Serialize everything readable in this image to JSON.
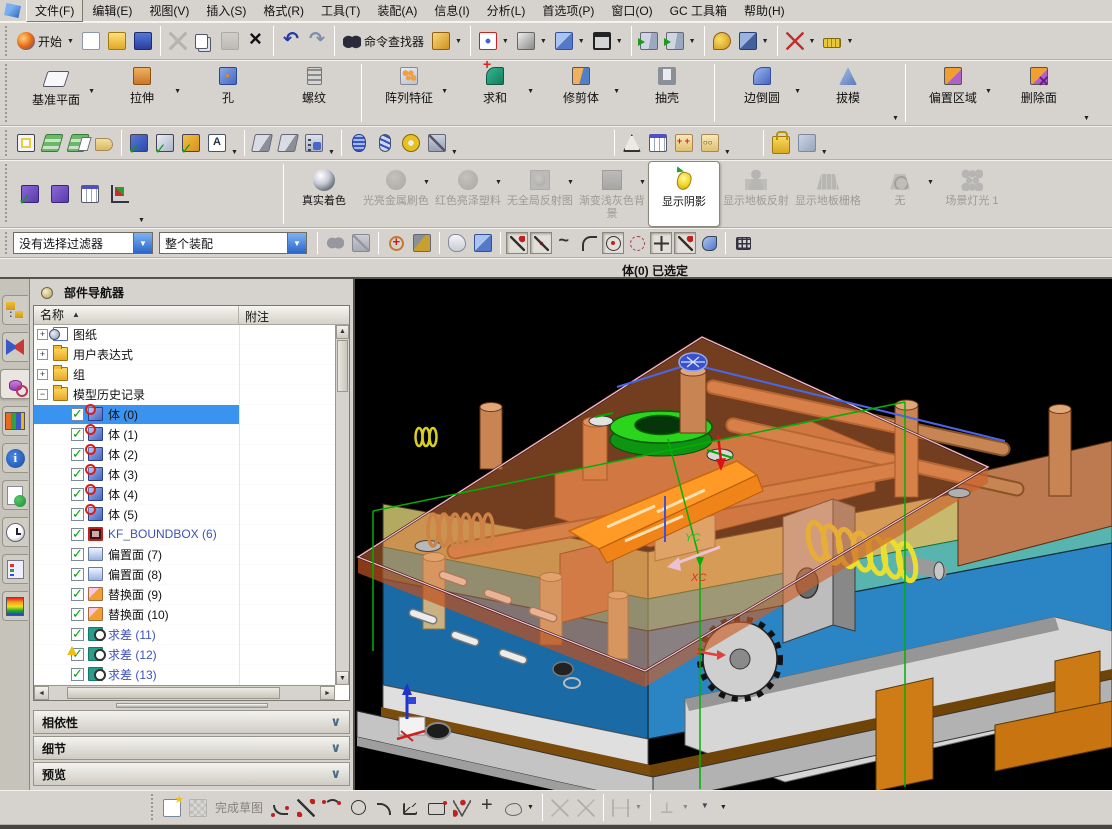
{
  "menu_bar": {
    "items": [
      "文件(F)",
      "编辑(E)",
      "视图(V)",
      "插入(S)",
      "格式(R)",
      "工具(T)",
      "装配(A)",
      "信息(I)",
      "分析(L)",
      "首选项(P)",
      "窗口(O)",
      "GC 工具箱",
      "帮助(H)"
    ]
  },
  "standard_toolbar": {
    "items": [
      {
        "icon": "nx-start-icon",
        "label": "开始",
        "dd": true
      },
      {
        "icon": "new-file-icon"
      },
      {
        "icon": "open-file-icon"
      },
      {
        "icon": "save-icon"
      },
      {
        "sep": true
      },
      {
        "icon": "cut-icon",
        "disabled": true
      },
      {
        "icon": "copy-icon"
      },
      {
        "icon": "paste-icon",
        "disabled": true
      },
      {
        "icon": "delete-icon"
      },
      {
        "sep": true
      },
      {
        "icon": "undo-icon"
      },
      {
        "icon": "redo-icon"
      },
      {
        "sep": true
      },
      {
        "icon": "command-finder-icon",
        "label": "命令查找器"
      },
      {
        "icon": "selection-box-icon",
        "dd": true
      },
      {
        "sep": true
      },
      {
        "icon": "fit-view-icon",
        "dd": true
      },
      {
        "icon": "shaded-view-icon",
        "dd": true
      },
      {
        "icon": "isometric-view-icon",
        "dd": true
      },
      {
        "icon": "window-bg-icon",
        "dd": true
      },
      {
        "sep": true
      },
      {
        "icon": "new-section-icon"
      },
      {
        "icon": "edit-section-icon",
        "dd": true
      },
      {
        "sep": true
      },
      {
        "icon": "appearance-icon"
      },
      {
        "icon": "render-style-icon",
        "dd": true
      },
      {
        "sep": true
      },
      {
        "icon": "measure-icon",
        "dd": true
      },
      {
        "icon": "ruler-icon",
        "dd": true
      }
    ]
  },
  "feature_toolbar": {
    "groups": [
      {
        "buttons": [
          {
            "label": "基准平面",
            "icon": "datum-plane-icon",
            "dd": true
          },
          {
            "label": "拉伸",
            "icon": "extrude-icon",
            "dd": true
          },
          {
            "label": "孔",
            "icon": "hole-icon"
          },
          {
            "label": "螺纹",
            "icon": "thread-icon"
          }
        ]
      },
      {
        "buttons": [
          {
            "label": "阵列特征",
            "icon": "pattern-feature-icon",
            "dd": true
          },
          {
            "label": "求和",
            "icon": "unite-icon",
            "dd": true
          },
          {
            "label": "修剪体",
            "icon": "trim-body-icon",
            "dd": true
          },
          {
            "label": "抽壳",
            "icon": "shell-icon"
          }
        ]
      },
      {
        "buttons": [
          {
            "label": "边倒圆",
            "icon": "edge-blend-icon",
            "dd": true
          },
          {
            "label": "拔模",
            "icon": "draft-icon"
          }
        ],
        "overflow": true
      },
      {
        "buttons": [
          {
            "label": "偏置区域",
            "icon": "offset-region-icon",
            "dd": true
          },
          {
            "label": "删除面",
            "icon": "delete-face-icon"
          }
        ],
        "overflow": true
      }
    ]
  },
  "utility_toolbar": {
    "groups": [
      {
        "icons": [
          "edit-display-icon",
          "layer-settings-icon",
          "layer-category-icon",
          "tag-icon"
        ]
      },
      {
        "icons": [
          "assembly-check-icon",
          "examine-geometry-icon",
          "feature-check-icon",
          "text-edit-icon"
        ],
        "overflow": true
      },
      {
        "icons": [
          "chamfer-check-icon",
          "deviation-icon",
          "select-hand-icon"
        ],
        "overflow": true
      },
      {
        "icons": [
          "coil-icon",
          "spring-icon",
          "washer-icon",
          "hide-component-icon"
        ],
        "overflow": true
      },
      {
        "gap": 150
      },
      {
        "icons": [
          "triangle-icon",
          "spreadsheet-icon",
          "point-cloud-icon",
          "curve-set-icon"
        ],
        "overflow": true
      },
      {
        "gap": 26
      },
      {
        "icons": [
          "lock-boxes-icon",
          "unlock-box-icon"
        ],
        "overflow": true
      }
    ]
  },
  "render_toolbar": {
    "left_icons": [
      "assembly-constraints-icon",
      "mating-icon",
      "expression-table-icon",
      "orient-view-icon"
    ],
    "buttons": [
      {
        "name": "true-shading",
        "label": "真实着色",
        "icon": "sphere-metal-icon",
        "enabled": true
      },
      {
        "name": "brushed-metal",
        "label": "光亮金属刷色",
        "icon": "sphere-dull-icon",
        "dd": true
      },
      {
        "name": "red-glossy-plastic",
        "label": "红色亮泽塑料",
        "icon": "sphere-dull-icon",
        "dd": true
      },
      {
        "name": "no-global-reflection",
        "label": "无全局反射图",
        "icon": "reflection-map-icon",
        "dd": true
      },
      {
        "name": "gradient-background",
        "label": "渐变浅灰色背景",
        "icon": "background-swatch-icon",
        "dd": true
      },
      {
        "name": "show-shadows",
        "label": "显示阴影",
        "icon": "bulb-icon",
        "enabled": true,
        "selected": true
      },
      {
        "name": "floor-reflection",
        "label": "显示地板反射",
        "icon": "floor-reflect-icon"
      },
      {
        "name": "floor-grid",
        "label": "显示地板栅格",
        "icon": "floor-grid-icon"
      },
      {
        "name": "floor-none",
        "label": "无",
        "icon": "floor-none-icon",
        "dd": true
      },
      {
        "name": "scene-lights",
        "label": "场景灯光 1",
        "icon": "scene-lights-icon"
      }
    ]
  },
  "selection_bar": {
    "filter_value": "没有选择过滤器",
    "scope_value": "整个装配",
    "icons": [
      "general-selection-icon",
      "deselect-icon",
      "rotate-wcs-icon",
      "snap-hammer-icon",
      "polygon-select-icon",
      "cube-select-icon"
    ],
    "snap_toggles": [
      {
        "icon": "snap-endpoint-icon",
        "cls": "sic-line",
        "pressed": true
      },
      {
        "icon": "snap-midpoint-icon",
        "cls": "sic-line2",
        "pressed": true
      },
      {
        "icon": "snap-curve-icon",
        "cls": "sic-curve"
      },
      {
        "icon": "snap-quadrant-icon",
        "cls": "sic-quad"
      },
      {
        "icon": "snap-center-icon",
        "cls": "sic-center",
        "pressed": true
      },
      {
        "icon": "snap-ellipse-icon",
        "cls": "sic-ellipse"
      },
      {
        "icon": "snap-intersection-icon",
        "cls": "sic-plus",
        "pressed": true
      },
      {
        "icon": "snap-point-on-curve-icon",
        "cls": "sic-line",
        "pressed": true
      },
      {
        "icon": "snap-face-icon",
        "cls": "sic-face"
      }
    ]
  },
  "status_bar": {
    "message": "体(0) 已选定"
  },
  "resource_bar": {
    "tabs": [
      {
        "icon": "assembly-navigator-icon"
      },
      {
        "icon": "constraint-navigator-icon"
      },
      {
        "icon": "part-navigator-icon",
        "selected": true
      },
      {
        "icon": "reuse-library-icon"
      },
      {
        "icon": "hd3d-tool-icon"
      },
      {
        "icon": "web-browser-icon"
      },
      {
        "icon": "history-icon"
      },
      {
        "icon": "system-materials-icon"
      },
      {
        "icon": "visualization-icon"
      }
    ]
  },
  "part_navigator": {
    "title": "部件导航器",
    "columns": [
      "名称",
      "附注"
    ],
    "tree": [
      {
        "label": "图纸",
        "expander": "+",
        "icon": "drawing-icon"
      },
      {
        "label": "用户表达式",
        "expander": "+",
        "icon": "folder-icon"
      },
      {
        "label": "组",
        "expander": "+",
        "icon": "folder-icon"
      },
      {
        "label": "模型历史记录",
        "expander": "-",
        "icon": "folder-icon"
      },
      {
        "label": "体 (0)",
        "checked": true,
        "icon": "body-icon",
        "selected": true,
        "child": true
      },
      {
        "label": "体 (1)",
        "checked": true,
        "icon": "body-icon",
        "child": true
      },
      {
        "label": "体 (2)",
        "checked": true,
        "icon": "body-icon",
        "child": true
      },
      {
        "label": "体 (3)",
        "checked": true,
        "icon": "body-icon",
        "child": true
      },
      {
        "label": "体 (4)",
        "checked": true,
        "icon": "body-icon",
        "child": true
      },
      {
        "label": "体 (5)",
        "checked": true,
        "icon": "body-icon",
        "child": true
      },
      {
        "label": "KF_BOUNDBOX (6)",
        "checked": true,
        "icon": "boundbox-icon",
        "link": true,
        "child": true
      },
      {
        "label": "偏置面 (7)",
        "checked": true,
        "icon": "offset-face-icon",
        "child": true
      },
      {
        "label": "偏置面 (8)",
        "checked": true,
        "icon": "offset-face-icon",
        "child": true
      },
      {
        "label": "替换面 (9)",
        "checked": true,
        "icon": "replace-face-icon",
        "child": true
      },
      {
        "label": "替换面 (10)",
        "checked": true,
        "icon": "replace-face-icon",
        "child": true
      },
      {
        "label": "求差 (11)",
        "checked": true,
        "icon": "subtract-icon",
        "link": true,
        "child": true
      },
      {
        "label": "求差 (12)",
        "checked": true,
        "icon": "subtract-icon",
        "link": true,
        "warning": true,
        "child": true
      },
      {
        "label": "求差 (13)",
        "checked": true,
        "icon": "subtract-icon",
        "link": true,
        "child": true
      }
    ],
    "sections": [
      "相依性",
      "细节",
      "预览"
    ]
  },
  "sketch_toolbar": {
    "items": [
      {
        "icon": "sketch-task-icon"
      },
      {
        "icon": "sketch-update-icon",
        "disabled": true
      },
      {
        "icon": "finish-sketch-icon",
        "label": "完成草图",
        "disabled": true,
        "nolabelicon": true
      },
      {
        "icon": "profile-icon"
      },
      {
        "icon": "line-icon"
      },
      {
        "icon": "arc-icon"
      },
      {
        "icon": "circle-icon"
      },
      {
        "icon": "fillet-icon"
      },
      {
        "icon": "chamfer-icon"
      },
      {
        "icon": "rectangle-icon"
      },
      {
        "icon": "polyline-icon"
      },
      {
        "icon": "point-icon"
      },
      {
        "icon": "spline-icon",
        "dd": true
      },
      {
        "sep": true
      },
      {
        "icon": "quick-trim-icon",
        "disabled": true
      },
      {
        "icon": "quick-extend-icon",
        "disabled": true
      },
      {
        "sep": true
      },
      {
        "icon": "dimension-icon",
        "disabled": true,
        "dd": true
      },
      {
        "sep": true
      },
      {
        "icon": "constraints-icon",
        "disabled": true,
        "dd": true
      },
      {
        "icon": "toolbar-overflow-icon",
        "dd": true
      }
    ]
  },
  "viewport": {
    "labels": {
      "xc": "XC",
      "yc": "YC"
    }
  }
}
